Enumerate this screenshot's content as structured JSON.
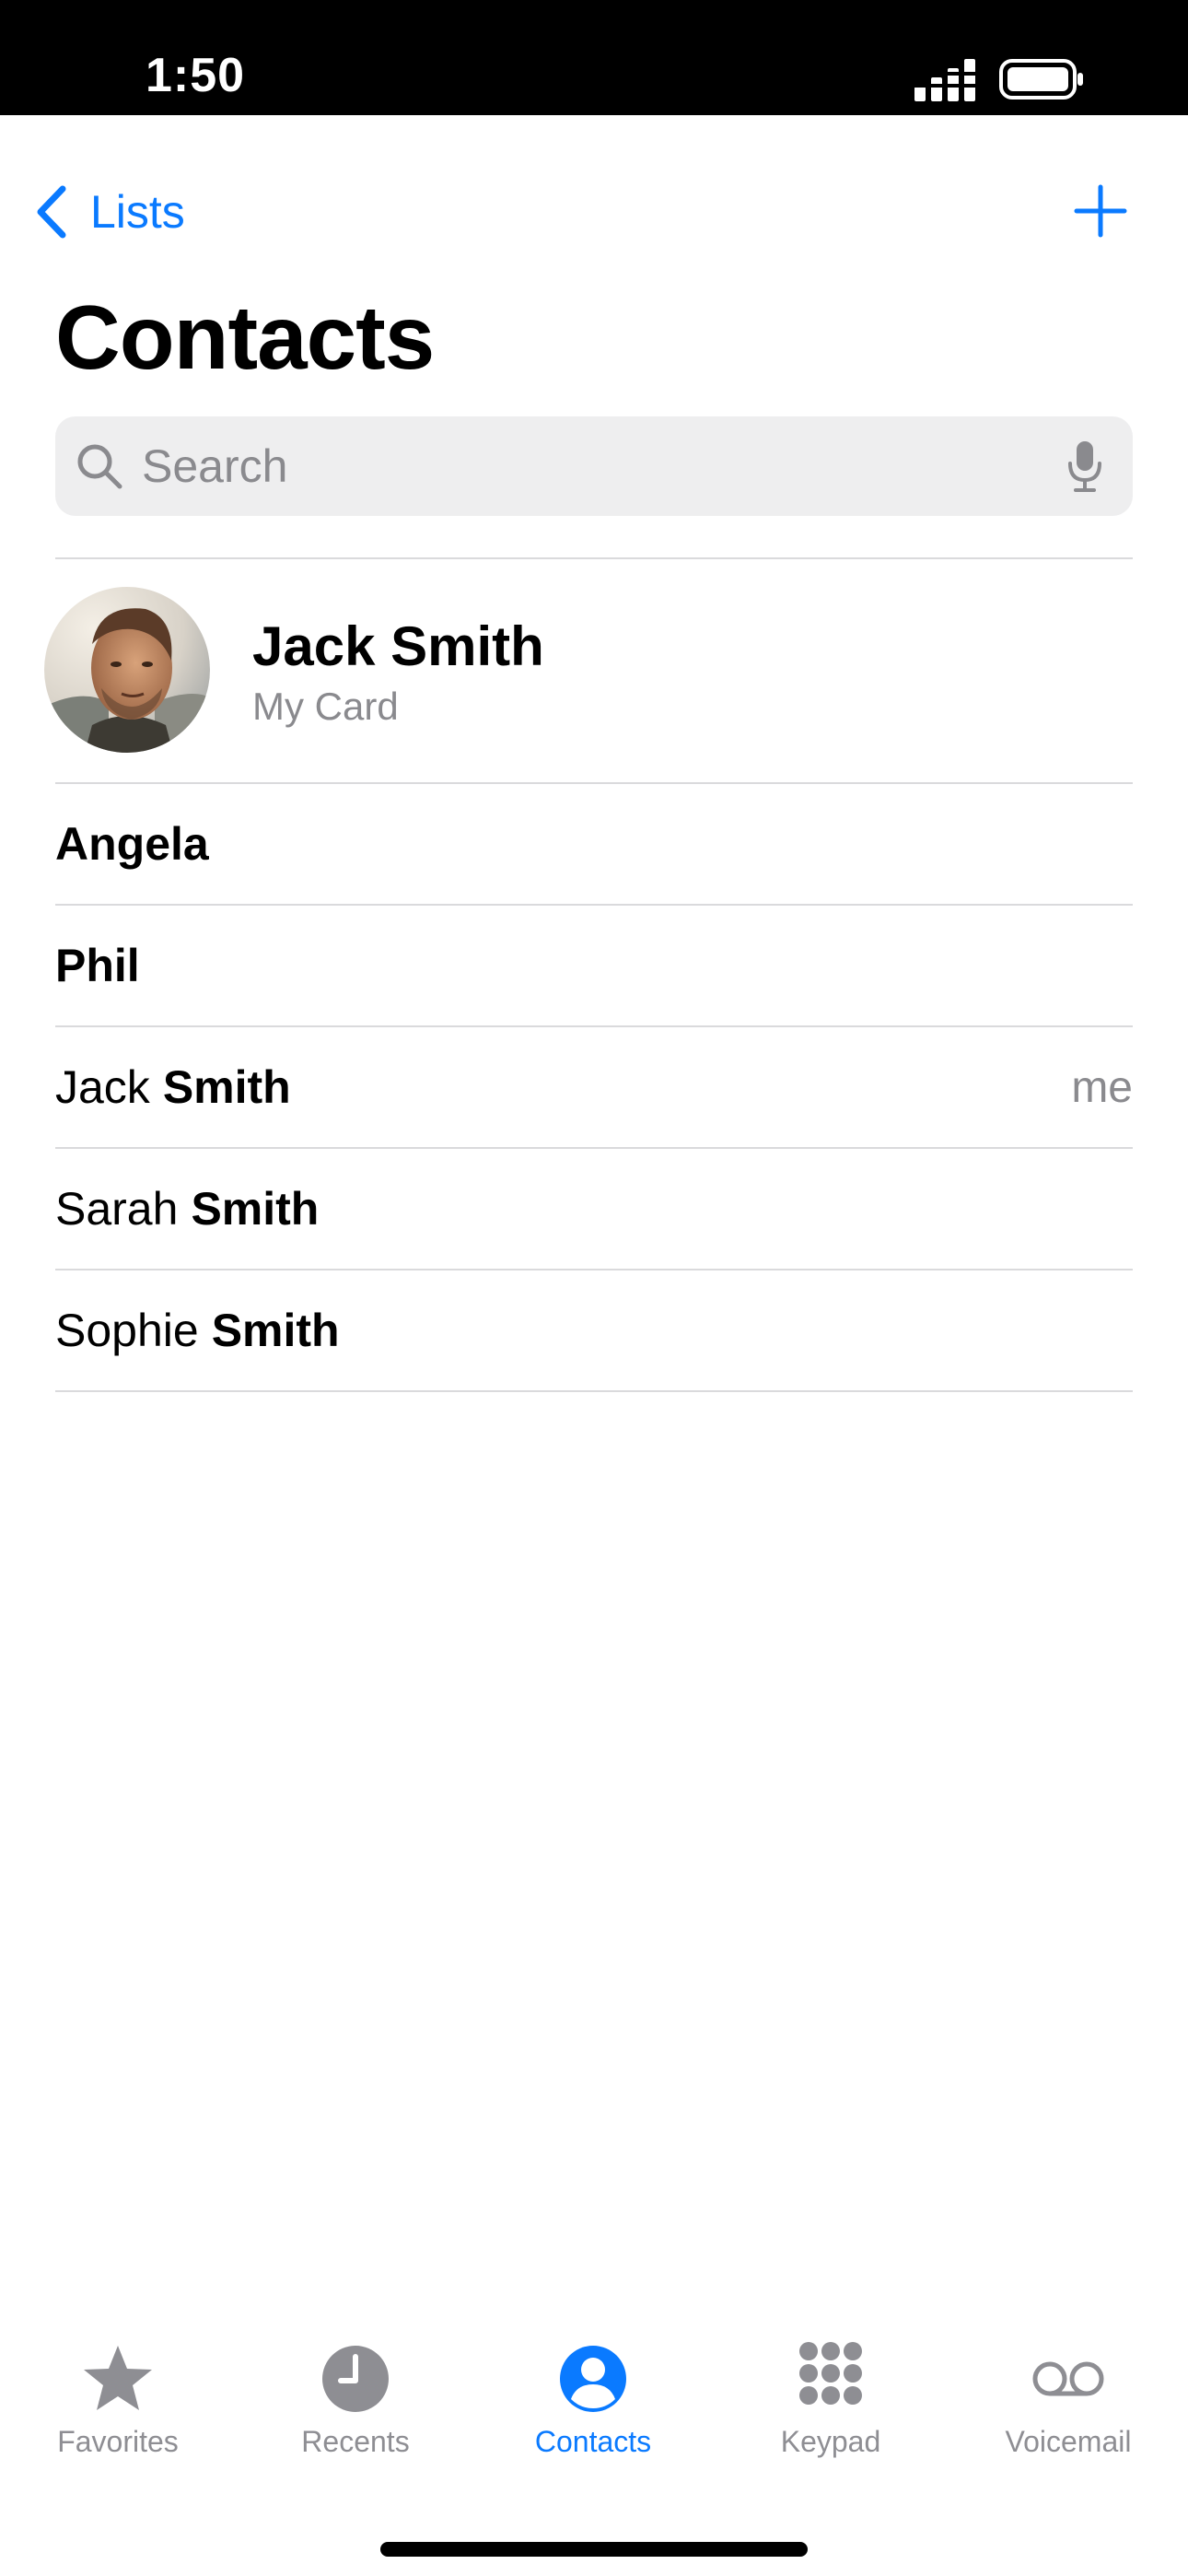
{
  "status_bar": {
    "time": "1:50"
  },
  "nav": {
    "back_label": "Lists",
    "title": "Contacts"
  },
  "search": {
    "placeholder": "Search"
  },
  "my_card": {
    "name": "Jack Smith",
    "subtitle": "My Card"
  },
  "contacts": [
    {
      "first": "",
      "last": "Angela",
      "tag": ""
    },
    {
      "first": "",
      "last": "Phil",
      "tag": ""
    },
    {
      "first": "Jack",
      "last": "Smith",
      "tag": "me"
    },
    {
      "first": "Sarah",
      "last": "Smith",
      "tag": ""
    },
    {
      "first": "Sophie",
      "last": "Smith",
      "tag": ""
    }
  ],
  "tabs": [
    {
      "label": "Favorites",
      "icon": "star-icon",
      "active": false
    },
    {
      "label": "Recents",
      "icon": "clock-icon",
      "active": false
    },
    {
      "label": "Contacts",
      "icon": "person-circle-icon",
      "active": true
    },
    {
      "label": "Keypad",
      "icon": "keypad-icon",
      "active": false
    },
    {
      "label": "Voicemail",
      "icon": "voicemail-icon",
      "active": false
    }
  ],
  "colors": {
    "accent": "#0a7aff",
    "secondary_text": "#8a8a8e",
    "tab_inactive": "#8e8e93"
  }
}
